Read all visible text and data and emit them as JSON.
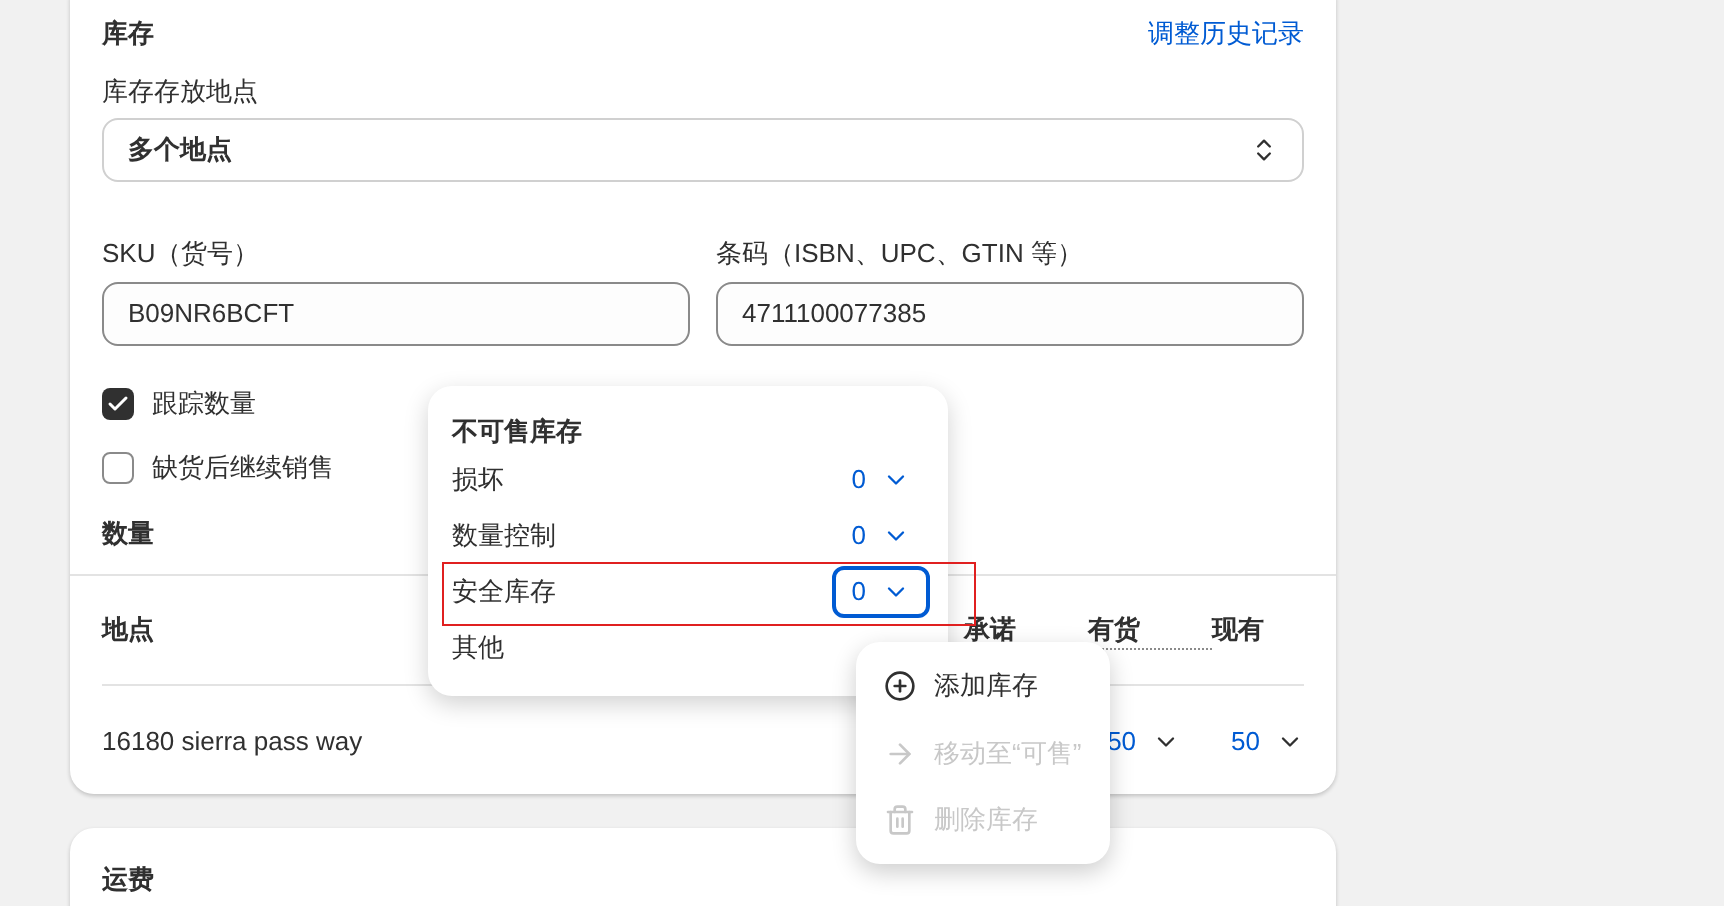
{
  "inventory": {
    "title": "库存",
    "history_link": "调整历史记录",
    "location_label": "库存存放地点",
    "location_value": "多个地点",
    "sku": {
      "label": "SKU（货号）",
      "value": "B09NR6BCFT"
    },
    "barcode": {
      "label": "条码（ISBN、UPC、GTIN 等）",
      "value": "4711100077385"
    },
    "checkboxes": [
      {
        "label": "跟踪数量",
        "checked": true
      },
      {
        "label": "缺货后继续销售",
        "checked": false
      }
    ],
    "quantity_title": "数量",
    "table": {
      "columns": [
        "地点",
        "承诺",
        "有货",
        "现有"
      ],
      "rows": [
        {
          "location": "16180 sierra pass way",
          "available": "50",
          "on_hand": "50"
        }
      ]
    }
  },
  "unavailable_popover": {
    "title": "不可售库存",
    "items": [
      {
        "label": "损坏",
        "value": "0",
        "focused": false
      },
      {
        "label": "数量控制",
        "value": "0",
        "focused": false
      },
      {
        "label": "安全库存",
        "value": "0",
        "focused": true
      },
      {
        "label": "其他"
      }
    ]
  },
  "action_menu": [
    {
      "label": "添加库存",
      "kind": "add",
      "disabled": false
    },
    {
      "label": "移动至“可售”",
      "kind": "move",
      "disabled": true
    },
    {
      "label": "删除库存",
      "kind": "delete",
      "disabled": true
    }
  ],
  "shipping": {
    "title": "运费"
  }
}
